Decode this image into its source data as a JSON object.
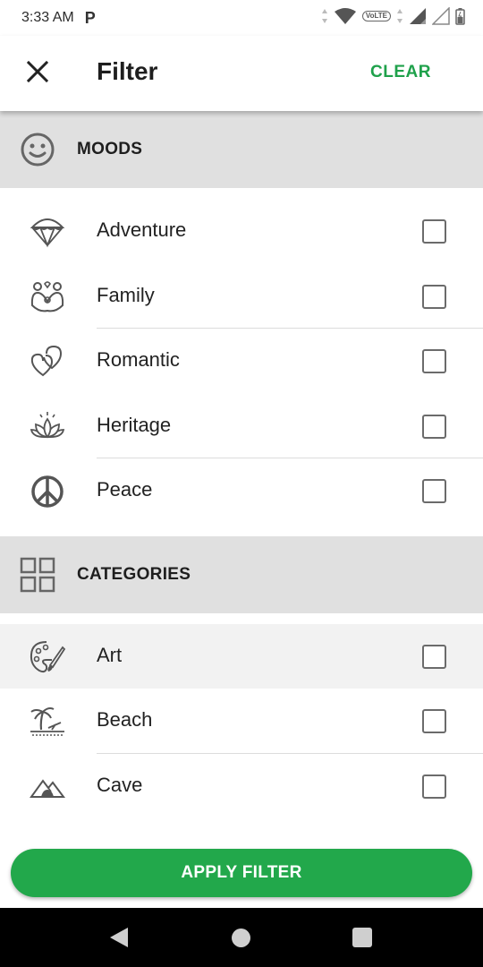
{
  "status_bar": {
    "time": "3:33 AM",
    "notification_letter": "P",
    "volte_label": "VoLTE"
  },
  "app_bar": {
    "title": "Filter",
    "clear_label": "CLEAR",
    "close_icon": "close-icon"
  },
  "sections": [
    {
      "label": "MOODS",
      "icon": "smiley-icon",
      "items": [
        {
          "label": "Adventure",
          "icon": "parachute-icon",
          "checked": false
        },
        {
          "label": "Family",
          "icon": "family-icon",
          "checked": false
        },
        {
          "label": "Romantic",
          "icon": "hearts-icon",
          "checked": false
        },
        {
          "label": "Heritage",
          "icon": "lotus-icon",
          "checked": false
        },
        {
          "label": "Peace",
          "icon": "peace-icon",
          "checked": false
        }
      ]
    },
    {
      "label": "CATEGORIES",
      "icon": "grid-icon",
      "items": [
        {
          "label": "Art",
          "icon": "palette-icon",
          "checked": false
        },
        {
          "label": "Beach",
          "icon": "beach-icon",
          "checked": false
        },
        {
          "label": "Cave",
          "icon": "cave-icon",
          "checked": false
        }
      ]
    }
  ],
  "apply_button": {
    "label": "APPLY FILTER"
  },
  "colors": {
    "accent": "#22a84b",
    "clear_text": "#1fa14b",
    "section_bg": "#e0e0e0"
  }
}
